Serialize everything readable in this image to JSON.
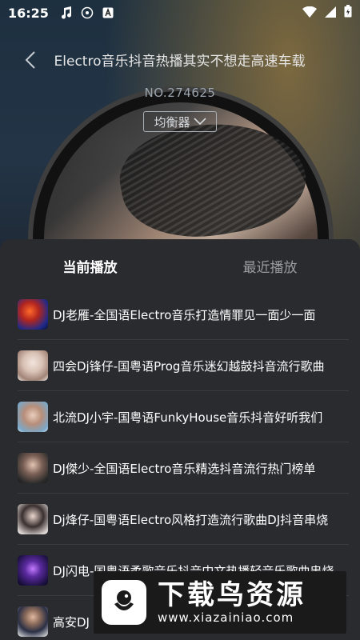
{
  "status_bar": {
    "time": "16:25"
  },
  "player": {
    "song_title": "Electro音乐抖音热播其实不想走高速车载",
    "track_no": "NO.274625",
    "eq_label": "均衡器"
  },
  "tabs": [
    {
      "label": "当前播放",
      "active": true
    },
    {
      "label": "最近播放",
      "active": false
    }
  ],
  "playlist": [
    {
      "title": "DJ老雁-全国语Electro音乐打造情罪见一面少一面"
    },
    {
      "title": "四会Dj锋仔-国粤语Prog音乐迷幻越鼓抖音流行歌曲"
    },
    {
      "title": "北流DJ小宇-国粤语FunkyHouse音乐抖音好听我们"
    },
    {
      "title": "DJ傑少-全国语Electro音乐精选抖音流行热门榜单"
    },
    {
      "title": "Dj烽仔-国粤语Electro风格打造流行歌曲DJ抖音串烧"
    },
    {
      "title": "DJ闪电-国粤语柔歌音乐抖音中文热播轻音乐歌曲串烧"
    },
    {
      "title": "高安DJ"
    }
  ],
  "watermark": {
    "title": "下载鸟资源",
    "url": "www.xiazainiao.com"
  }
}
